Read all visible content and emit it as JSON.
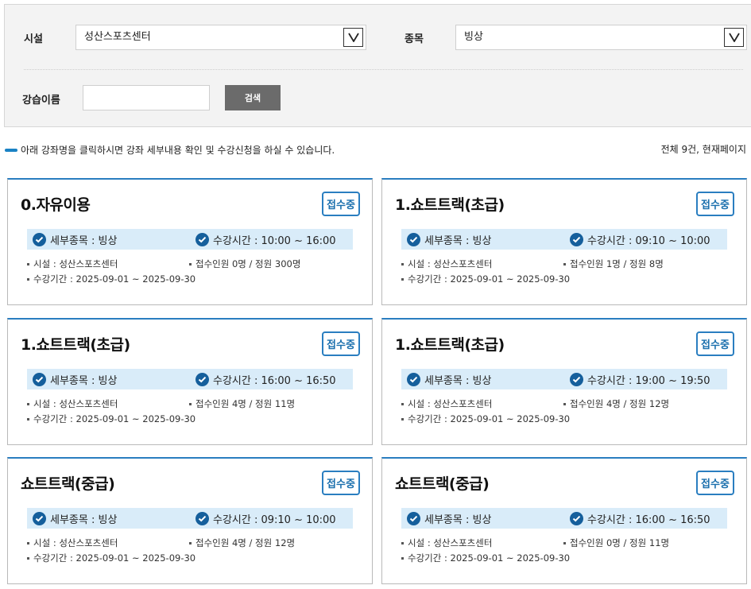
{
  "search": {
    "facility_label": "시설",
    "facility_value": "성산스포츠센터",
    "sport_label": "종목",
    "sport_value": "빙상",
    "class_name_label": "강습이름",
    "class_name_value": "",
    "search_button": "검색"
  },
  "notice": "아래 강좌명을 클릭하시면 강좌 세부내용 확인 및 수강신청을 하실 수 있습니다.",
  "total": "전체 9건, 현재페이지",
  "cards": [
    {
      "title": "0.자유이용",
      "status": "접수중",
      "sub_sport": "세부종목 : 빙상",
      "time": "수강시간 : 10:00 ~ 16:00",
      "facility": "시설 : 성산스포츠센터",
      "enroll": "접수인원 0명 / 정원 300명",
      "period": "수강기간 : 2025-09-01 ~ 2025-09-30"
    },
    {
      "title": "1.쇼트트랙(초급)",
      "status": "접수중",
      "sub_sport": "세부종목 : 빙상",
      "time": "수강시간 : 09:10 ~ 10:00",
      "facility": "시설 : 성산스포츠센터",
      "enroll": "접수인원 1명 / 정원 8명",
      "period": "수강기간 : 2025-09-01 ~ 2025-09-30"
    },
    {
      "title": "1.쇼트트랙(초급)",
      "status": "접수중",
      "sub_sport": "세부종목 : 빙상",
      "time": "수강시간 : 16:00 ~ 16:50",
      "facility": "시설 : 성산스포츠센터",
      "enroll": "접수인원 4명 / 정원 11명",
      "period": "수강기간 : 2025-09-01 ~ 2025-09-30"
    },
    {
      "title": "1.쇼트트랙(초급)",
      "status": "접수중",
      "sub_sport": "세부종목 : 빙상",
      "time": "수강시간 : 19:00 ~ 19:50",
      "facility": "시설 : 성산스포츠센터",
      "enroll": "접수인원 4명 / 정원 12명",
      "period": "수강기간 : 2025-09-01 ~ 2025-09-30"
    },
    {
      "title": "쇼트트랙(중급)",
      "status": "접수중",
      "sub_sport": "세부종목 : 빙상",
      "time": "수강시간 : 09:10 ~ 10:00",
      "facility": "시설 : 성산스포츠센터",
      "enroll": "접수인원 4명 / 정원 12명",
      "period": "수강기간 : 2025-09-01 ~ 2025-09-30"
    },
    {
      "title": "쇼트트랙(중급)",
      "status": "접수중",
      "sub_sport": "세부종목 : 빙상",
      "time": "수강시간 : 16:00 ~ 16:50",
      "facility": "시설 : 성산스포츠센터",
      "enroll": "접수인원 0명 / 정원 11명",
      "period": "수강기간 : 2025-09-01 ~ 2025-09-30"
    }
  ],
  "colors": {
    "accent": "#2a7ec0",
    "strip": "#d9ecf9",
    "check": "#155f9c",
    "button": "#6b6b6b"
  }
}
